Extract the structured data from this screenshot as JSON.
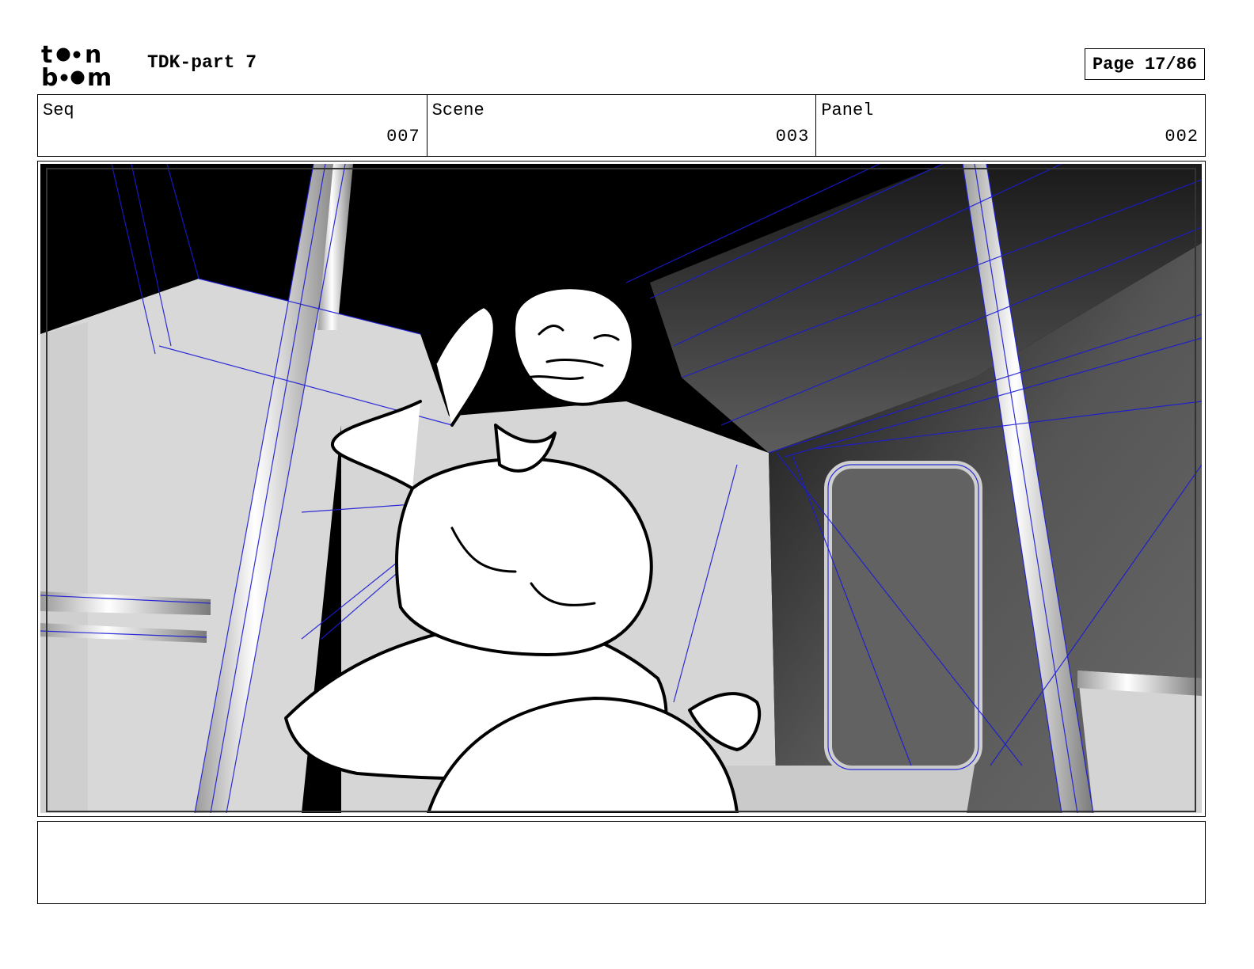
{
  "header": {
    "logo_text_top": "toon",
    "logo_text_bottom": "boom",
    "doc_title": "TDK-part 7",
    "page_prefix": "Page",
    "page_value": "17/86"
  },
  "info": {
    "seq_label": "Seq",
    "seq_value": "007",
    "scene_label": "Scene",
    "scene_value": "003",
    "panel_label": "Panel",
    "panel_value": "002"
  },
  "panel": {
    "image_icon": "storyboard-sketch",
    "description_alt": ""
  },
  "notes": {
    "text": ""
  },
  "colors": {
    "wireframe": "#1a1ad6",
    "ceiling": "#000000",
    "wall_light": "#d6d6d6",
    "wall_dark": "#5a5a5a"
  }
}
